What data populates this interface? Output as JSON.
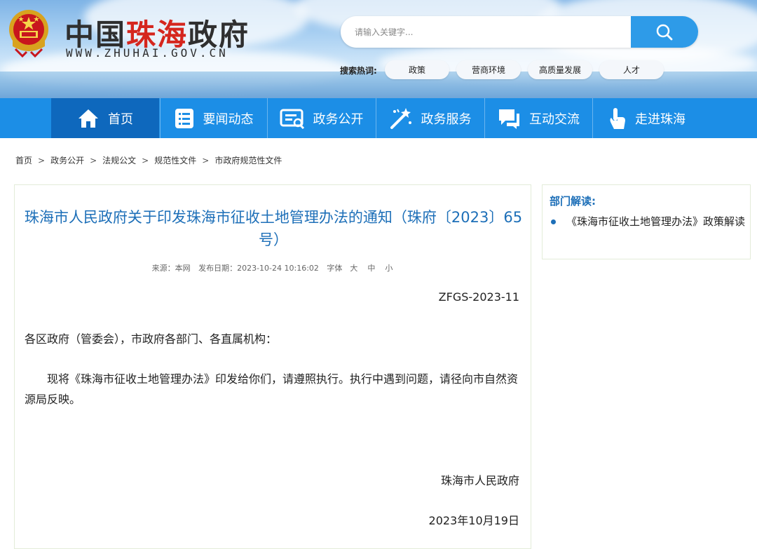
{
  "header": {
    "site_title_part1": "中国",
    "site_title_part2": "珠海",
    "site_title_part3": "政府",
    "domain": "WWW.ZHUHAI.GOV.CN",
    "search_placeholder": "请输入关键字...",
    "hot_label": "搜索热词:",
    "hot_tags": [
      "政策",
      "营商环境",
      "高质量发展",
      "人才"
    ]
  },
  "nav": {
    "items": [
      {
        "label": "首页",
        "icon": "home-icon",
        "active": true
      },
      {
        "label": "要闻动态",
        "icon": "news-list-icon"
      },
      {
        "label": "政务公开",
        "icon": "document-icon"
      },
      {
        "label": "政务服务",
        "icon": "magic-wand-icon"
      },
      {
        "label": "互动交流",
        "icon": "chat-icon"
      },
      {
        "label": "走进珠海",
        "icon": "hand-pointer-icon"
      }
    ]
  },
  "breadcrumb": [
    "首页",
    "政务公开",
    "法规公文",
    "规范性文件",
    "市政府规范性文件"
  ],
  "article": {
    "title": "珠海市人民政府关于印发珠海市征收土地管理办法的通知（珠府〔2023〕65号）",
    "source_label": "来源：本网",
    "date_label": "发布日期：2023-10-24 10:16:02",
    "font_label": "字体",
    "font_sizes": [
      "大",
      "中",
      "小"
    ],
    "doc_number": "ZFGS-2023-11",
    "salutation": "各区政府（管委会），市政府各部门、各直属机构：",
    "body": "现将《珠海市征收土地管理办法》印发给你们，请遵照执行。执行中遇到问题，请径向市自然资源局反映。",
    "signature": "珠海市人民政府",
    "signed_date": "2023年10月19日"
  },
  "sidebar": {
    "title": "部门解读:",
    "items": [
      "《珠海市征收土地管理办法》政策解读"
    ]
  },
  "colors": {
    "nav_bg": "#1c8ee6",
    "nav_active": "#0e68bd",
    "title_blue": "#1d6fb8",
    "brand_red": "#d5261e",
    "search_button": "#2e9be8"
  }
}
